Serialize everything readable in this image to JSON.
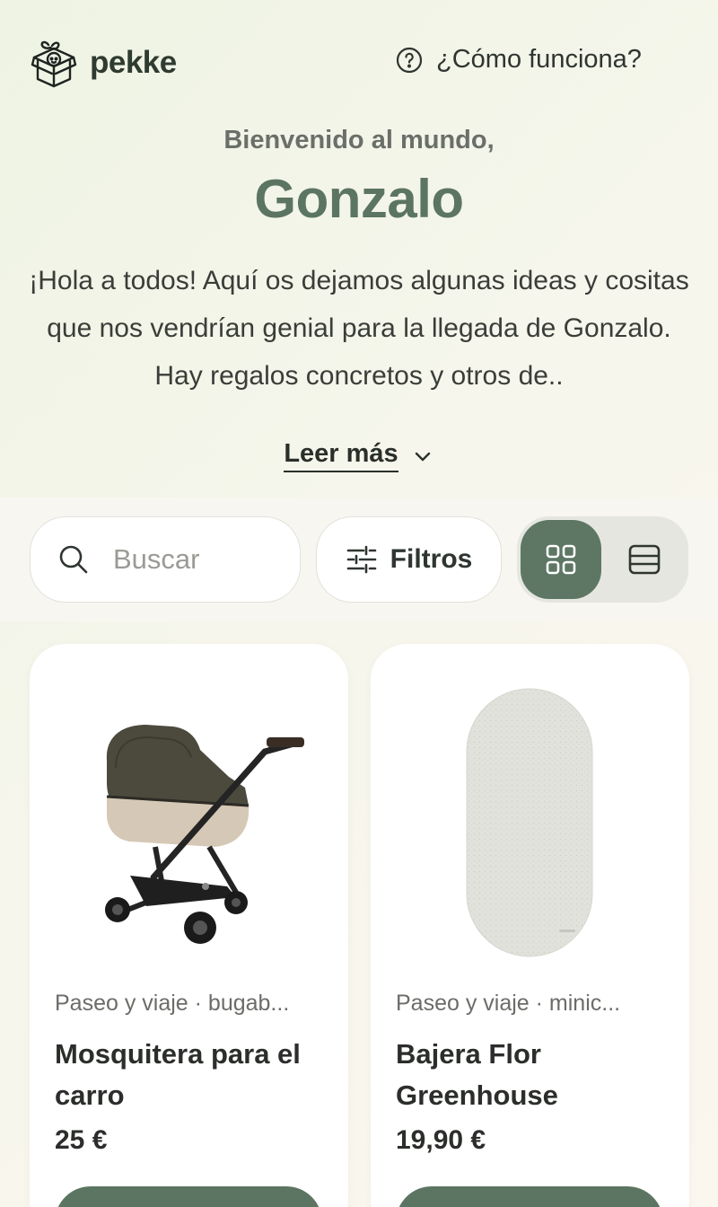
{
  "header": {
    "brand": "pekke",
    "help_link": "¿Cómo funciona?"
  },
  "hero": {
    "greeting": "Bienvenido al mundo,",
    "name": "Gonzalo",
    "intro": "¡Hola a todos! Aquí os dejamos algunas ideas y cositas que nos vendrían genial para la llegada de Gonzalo. Hay regalos concretos y otros de..",
    "read_more": "Leer más"
  },
  "toolbar": {
    "search_placeholder": "Buscar",
    "filters_label": "Filtros",
    "view_mode": "grid"
  },
  "products": [
    {
      "category": "Paseo y viaje · bugab...",
      "title": "Mosquitera para el carro",
      "price": "25 €"
    },
    {
      "category": "Paseo y viaje · minic...",
      "title": "Bajera Flor Greenhouse",
      "price": "19,90 €"
    }
  ],
  "colors": {
    "accent": "#5b7562",
    "background": "#f3f4ea"
  },
  "icons": {
    "logo": "gift-box-baby-icon",
    "help": "question-circle-icon",
    "search": "search-icon",
    "filters": "sliders-icon",
    "grid_view": "grid-icon",
    "list_view": "list-icon",
    "read_more": "chevron-down-icon"
  }
}
